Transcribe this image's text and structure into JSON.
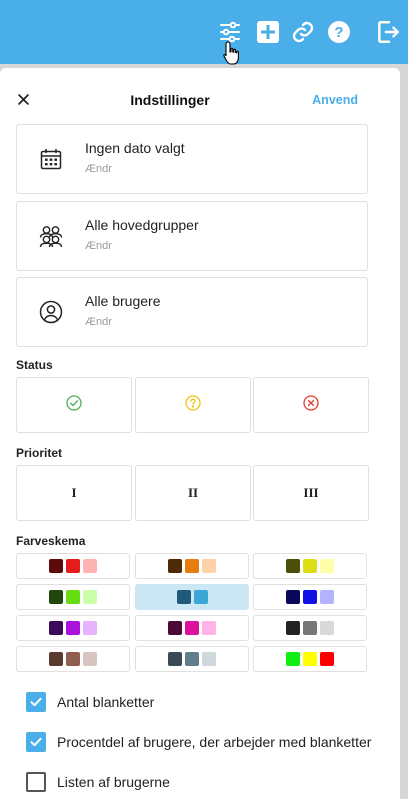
{
  "toolbar": {
    "icons": [
      "sliders-icon",
      "add-icon",
      "link-icon",
      "help-icon",
      "logout-icon"
    ],
    "accent": "#4aaee9"
  },
  "header": {
    "title": "Indstillinger",
    "apply_label": "Anvend"
  },
  "filters": [
    {
      "title": "Ingen dato valgt",
      "sub": "Ændr",
      "icon": "calendar-icon"
    },
    {
      "title": "Alle hovedgrupper",
      "sub": "Ændr",
      "icon": "group-icon"
    },
    {
      "title": "Alle brugere",
      "sub": "Ændr",
      "icon": "user-icon"
    }
  ],
  "status": {
    "label": "Status",
    "options": [
      {
        "icon": "check-circle-icon",
        "color": "#4caf50"
      },
      {
        "icon": "question-circle-icon",
        "color": "#f4c20d"
      },
      {
        "icon": "cross-circle-icon",
        "color": "#e53935"
      }
    ]
  },
  "priority": {
    "label": "Prioritet",
    "options": [
      "I",
      "II",
      "III"
    ]
  },
  "color_scheme": {
    "label": "Farveskema",
    "selected_index": 4,
    "schemes": [
      [
        "#5c0a0a",
        "#e51c1c",
        "#ffb3b3"
      ],
      [
        "#4e2a07",
        "#e67c0c",
        "#ffd1a8"
      ],
      [
        "#4d4d0a",
        "#dede17",
        "#ffffaa"
      ],
      [
        "#21470c",
        "#66dd11",
        "#ccffaa"
      ],
      [
        "#1e5a7a",
        "#3aa7d6"
      ],
      [
        "#08085c",
        "#1010e6",
        "#b3b3ff"
      ],
      [
        "#3d0a5a",
        "#aa11dd",
        "#e6b3ff"
      ],
      [
        "#4d0a36",
        "#dd1199",
        "#ffb3e6"
      ],
      [
        "#222222",
        "#777777",
        "#d9d9d9"
      ],
      [
        "#5a3a2e",
        "#8f5e4f",
        "#d8c5bf"
      ],
      [
        "#3a4a55",
        "#607d8b",
        "#cfd8dc"
      ],
      [
        "#11ee11",
        "#ffff00",
        "#ff0000"
      ]
    ]
  },
  "checkboxes": [
    {
      "label": "Antal blanketter",
      "checked": true
    },
    {
      "label": "Procentdel af brugere, der arbejder med blanketter",
      "checked": true
    },
    {
      "label": "Listen af brugerne",
      "checked": false
    }
  ]
}
